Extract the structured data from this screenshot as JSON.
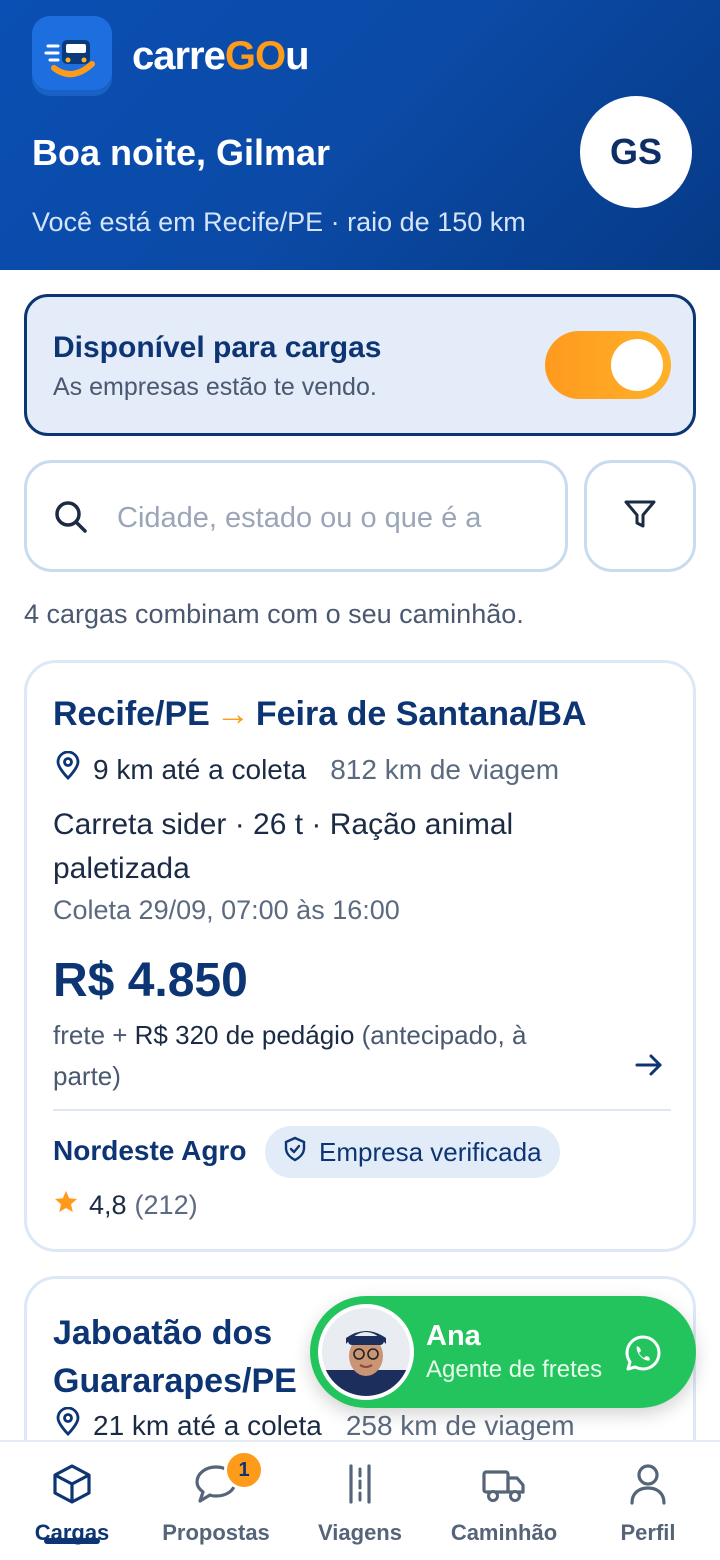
{
  "app": {
    "brand_prefix": "carre",
    "brand_go": "GO",
    "brand_suffix": "u",
    "greeting": "Boa noite, Gilmar",
    "location": "Você está em Recife/PE · raio de 150 km",
    "avatar_initials": "GS"
  },
  "availability": {
    "title": "Disponível para cargas",
    "subtitle": "As empresas estão te vendo.",
    "enabled": true
  },
  "search": {
    "placeholder": "Cidade, estado ou o que é a",
    "value": ""
  },
  "results_text": "4 cargas combinam com o seu caminhão.",
  "loads": [
    {
      "origin": "Recife/PE",
      "destination": "Feira de Santana/BA",
      "pickup_distance": "9 km até a coleta",
      "trip_distance": "812 km de viagem",
      "spec": "Carreta sider · 26 t · Ração animal paletizada",
      "pickup_window": "Coleta 29/09, 07:00 às 16:00",
      "price": "R$ 4.850",
      "fee_prefix": "frete + ",
      "fee_toll": "R$ 320 de pedágio",
      "fee_suffix": " (antecipado, à parte)",
      "company": "Nordeste Agro",
      "verified_label": "Empresa verificada",
      "rating": "4,8",
      "rating_count": "(212)"
    },
    {
      "origin": "Jaboatão dos Guararapes/PE",
      "pickup_distance": "21 km até a coleta",
      "trip_distance": "258 km de viagem"
    }
  ],
  "agent": {
    "name": "Ana",
    "role": "Agente de fretes"
  },
  "nav": {
    "items": [
      {
        "label": "Cargas",
        "icon": "box-icon",
        "active": true
      },
      {
        "label": "Propostas",
        "icon": "chat-bubble-icon",
        "badge": "1"
      },
      {
        "label": "Viagens",
        "icon": "road-icon"
      },
      {
        "label": "Caminhão",
        "icon": "truck-icon"
      },
      {
        "label": "Perfil",
        "icon": "person-icon"
      }
    ]
  },
  "colors": {
    "primary": "#0d3574",
    "accent": "#ff9b1a",
    "whatsapp": "#23c45e"
  }
}
